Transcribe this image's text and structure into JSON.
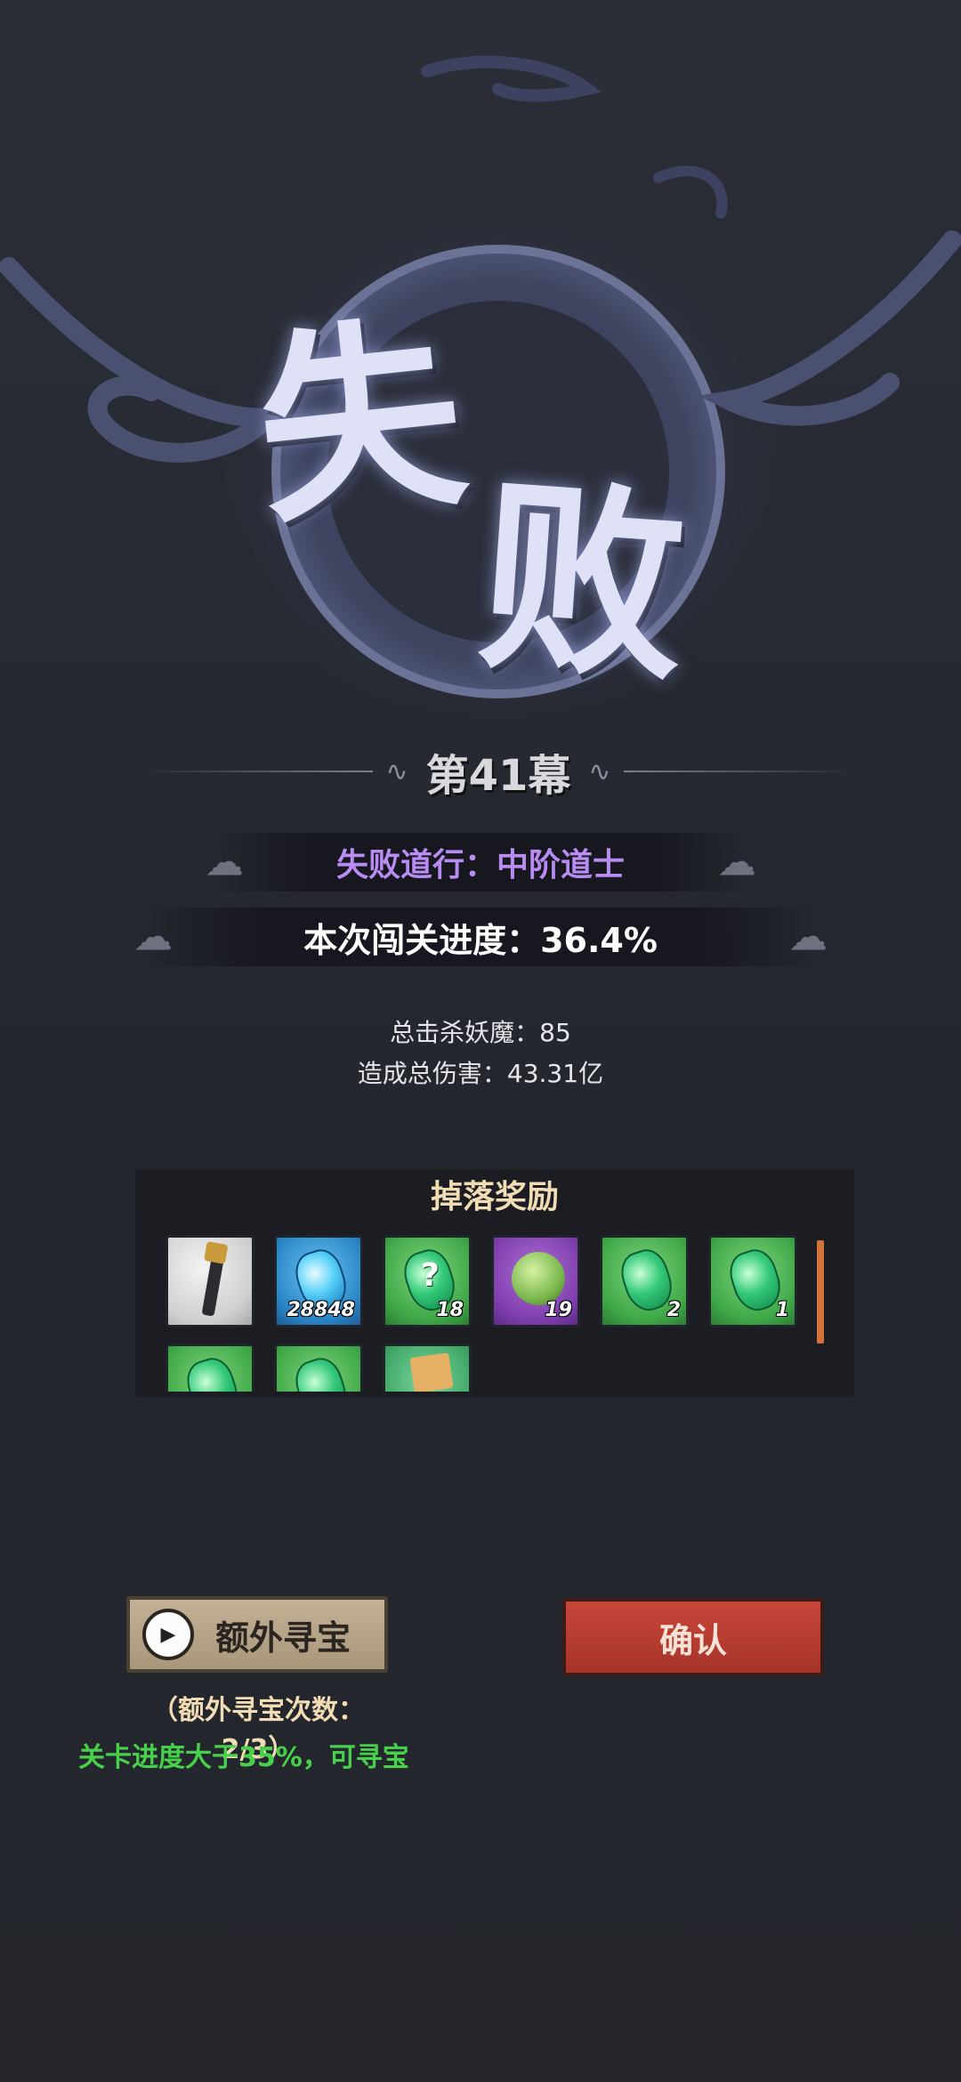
{
  "result_title": {
    "char_1": "失",
    "char_2": "败"
  },
  "chapter": "第41幕",
  "rank_line": "失败道行：中阶道士",
  "progress_line": "本次闯关进度：36.4%",
  "stats": {
    "kills": "总击杀妖魔：85",
    "damage": "造成总伤害：43.31亿"
  },
  "loot": {
    "title": "掉落奖励",
    "items": [
      {
        "icon": "weapon-icon",
        "count": ""
      },
      {
        "icon": "blue-gem-icon",
        "count": "28848"
      },
      {
        "icon": "mystery-green-gem-icon",
        "count": "18"
      },
      {
        "icon": "purple-orb-icon",
        "count": "19"
      },
      {
        "icon": "green-gem-icon",
        "count": "2"
      },
      {
        "icon": "green-gem-icon",
        "count": "1"
      },
      {
        "icon": "green-gem-icon",
        "count": ""
      },
      {
        "icon": "green-gem-icon",
        "count": ""
      },
      {
        "icon": "scroll-icon",
        "count": ""
      }
    ]
  },
  "buttons": {
    "extra_treasure": "额外寻宝",
    "confirm": "确认"
  },
  "hints": {
    "remaining": "（额外寻宝次数：2/3）",
    "condition": "关卡进度大于35%，可寻宝"
  },
  "colors": {
    "rank_text": "#b88cf2",
    "condition_text": "#47d14b",
    "confirm_button": "#b83c30",
    "treasure_button": "#b7a689"
  }
}
